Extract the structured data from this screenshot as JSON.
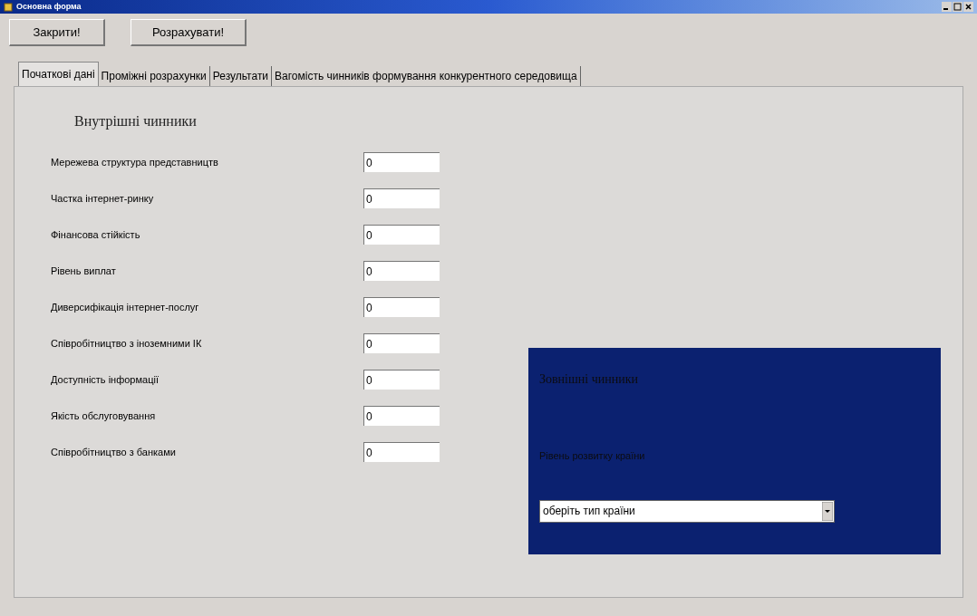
{
  "window": {
    "title": "Основна форма"
  },
  "buttons": [
    "Закрити!",
    "Розрахувати!"
  ],
  "tabs": [
    {
      "label": "Початкові дані",
      "selected": true
    },
    {
      "label": "Проміжні розрахунки",
      "selected": false
    },
    {
      "label": "Результати",
      "selected": false
    },
    {
      "label": "Вагомість чинників формування конкурентного середовища",
      "selected": false
    }
  ],
  "internal": {
    "heading": "Внутрішні чинники",
    "fields": [
      {
        "label": "Мережева структура представництв",
        "value": "0"
      },
      {
        "label": "Частка інтернет-ринку",
        "value": "0"
      },
      {
        "label": "Фінансова стійкість",
        "value": "0"
      },
      {
        "label": "Рівень виплат",
        "value": "0"
      },
      {
        "label": "Диверсифікація інтернет-послуг",
        "value": "0"
      },
      {
        "label": "Співробітництво з іноземними ІК",
        "value": "0"
      },
      {
        "label": "Доступність інформації",
        "value": "0"
      },
      {
        "label": "Якість обслуговування",
        "value": "0"
      },
      {
        "label": "Співробітництво з банками",
        "value": "0"
      }
    ]
  },
  "external": {
    "heading": "Зовнішні чинники",
    "label": "Рівень розвитку країни",
    "dropdown": {
      "value": "оберіть тип країни"
    }
  }
}
